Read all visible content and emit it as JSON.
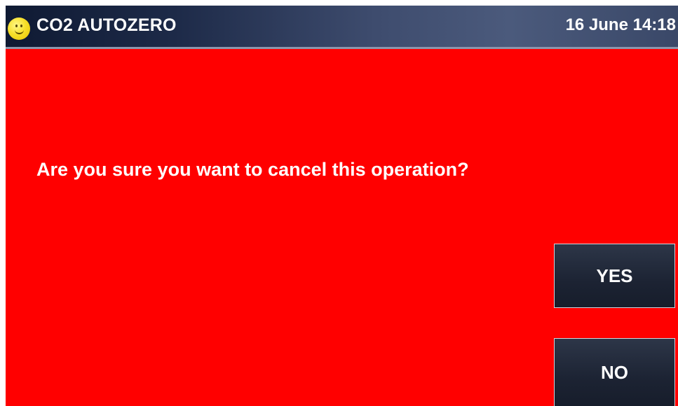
{
  "header": {
    "title": "CO2 AUTOZERO",
    "datetime": "16 June 14:18",
    "status_icon": "smiley-face-icon"
  },
  "dialog": {
    "message": "Are you sure you want to cancel this operation?",
    "yes_label": "YES",
    "no_label": "NO"
  },
  "colors": {
    "background": "#ff0000",
    "header": "#1d2a48",
    "button": "#1c2333",
    "text": "#ffffff"
  }
}
